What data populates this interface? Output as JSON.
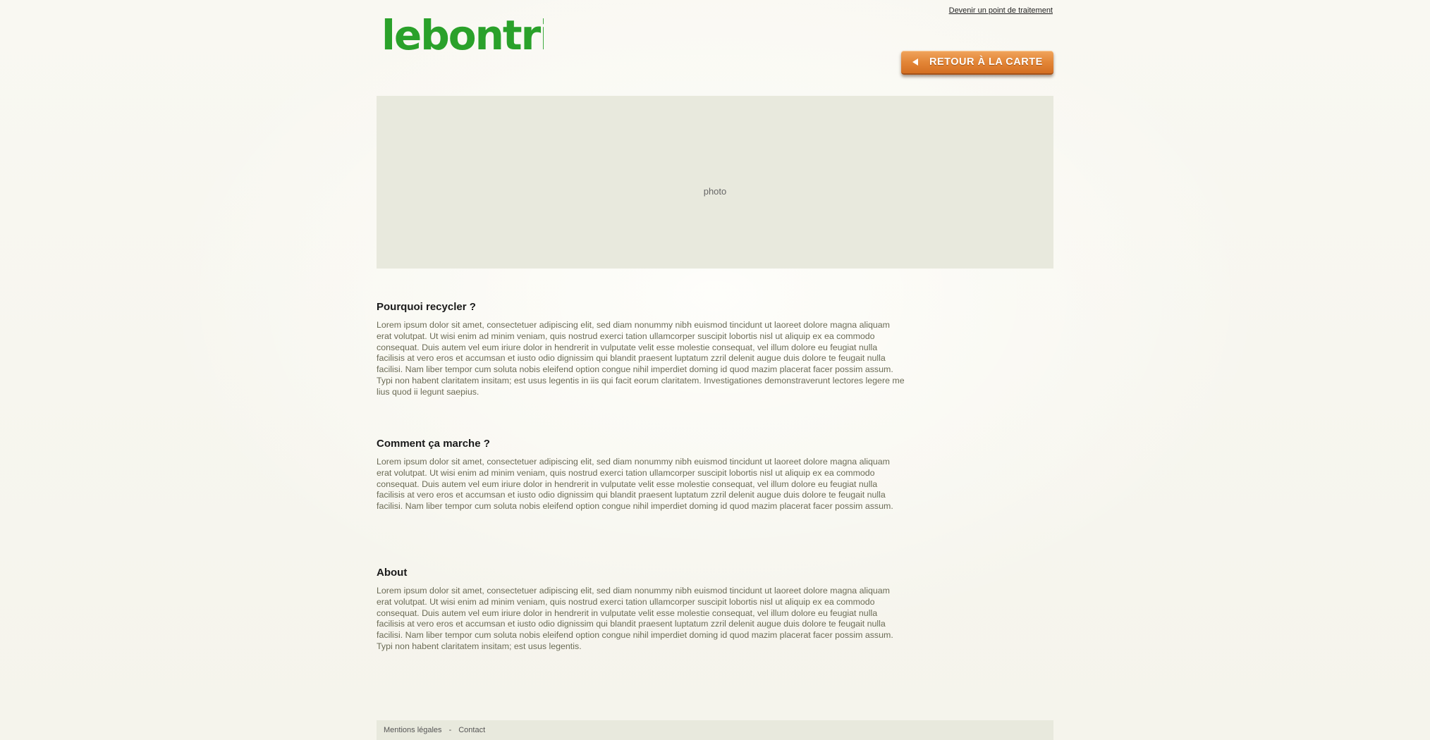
{
  "header": {
    "top_link": "Devenir un point de traitement",
    "logo_text": "lebontri",
    "back_button": "RETOUR À LA CARTE"
  },
  "photo": {
    "placeholder": "photo"
  },
  "sections": [
    {
      "title": "Pourquoi recycler ?",
      "body": "Lorem ipsum dolor sit amet, consectetuer adipiscing elit, sed diam nonummy nibh euismod tincidunt ut laoreet dolore magna aliquam erat volutpat. Ut wisi enim ad minim veniam, quis nostrud exerci tation ullamcorper suscipit lobortis nisl ut aliquip ex ea commodo consequat. Duis autem vel eum iriure dolor in hendrerit in vulputate velit esse molestie consequat, vel illum dolore eu feugiat nulla facilisis at vero eros et accumsan et iusto odio dignissim qui blandit praesent luptatum zzril delenit augue duis dolore te feugait nulla facilisi. Nam liber tempor cum soluta nobis eleifend option congue nihil imperdiet doming id quod mazim placerat facer possim assum. Typi non habent claritatem insitam; est usus legentis in iis qui facit eorum claritatem. Investigationes demonstraverunt lectores legere me lius quod ii legunt saepius."
    },
    {
      "title": "Comment ça marche ?",
      "body": "Lorem ipsum dolor sit amet, consectetuer adipiscing elit, sed diam nonummy nibh euismod tincidunt ut laoreet dolore magna aliquam erat volutpat. Ut wisi enim ad minim veniam, quis nostrud exerci tation ullamcorper suscipit lobortis nisl ut aliquip ex ea commodo consequat. Duis autem vel eum iriure dolor in hendrerit in vulputate velit esse molestie consequat, vel illum dolore eu feugiat nulla facilisis at vero eros et accumsan et iusto odio dignissim qui blandit praesent luptatum zzril delenit augue duis dolore te feugait nulla facilisi. Nam liber tempor cum soluta nobis eleifend option congue nihil imperdiet doming id quod mazim placerat facer possim assum."
    },
    {
      "title": "About",
      "body": "Lorem ipsum dolor sit amet, consectetuer adipiscing elit, sed diam nonummy nibh euismod tincidunt ut laoreet dolore magna aliquam erat volutpat. Ut wisi enim ad minim veniam, quis nostrud exerci tation ullamcorper suscipit lobortis nisl ut aliquip ex ea commodo consequat. Duis autem vel eum iriure dolor in hendrerit in vulputate velit esse molestie consequat, vel illum dolore eu feugiat nulla facilisis at vero eros et accumsan et iusto odio dignissim qui blandit praesent luptatum zzril delenit augue duis dolore te feugait nulla facilisi. Nam liber tempor cum soluta nobis eleifend option congue nihil imperdiet doming id quod mazim placerat facer possim assum. Typi non habent claritatem insitam; est usus legentis."
    }
  ],
  "footer": {
    "legal_link": "Mentions légales",
    "separator": "-",
    "contact_link": "Contact"
  },
  "colors": {
    "logo_green": "#2aa12a",
    "button_orange": "#e38637",
    "panel_bg": "#e8e9dd"
  },
  "icons": {
    "back_arrow": "triangle-left-icon"
  }
}
